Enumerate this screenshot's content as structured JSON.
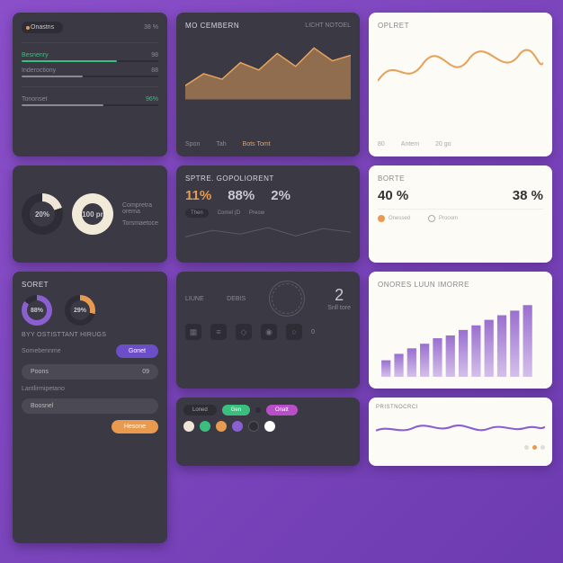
{
  "card1": {
    "tab": "Onastns",
    "pct_right": "38 %",
    "m1_label": "Besnenry",
    "m1_value": "98",
    "m2_label": "Inderoctiony",
    "m2_value": "88",
    "m3_label": "Tononset",
    "m3_value": "96%"
  },
  "card2": {
    "title": "MO CEMBERN",
    "title2": "LICHT NOTOEL",
    "stats": [
      "Spon",
      "Tah",
      "Bots Tomt"
    ]
  },
  "card3": {
    "title": "OPLRET",
    "stats": [
      "80",
      "Antem",
      "20 go"
    ]
  },
  "card4": {
    "d1": "20%",
    "d2": "100 pr",
    "cap1": "Compretra orema",
    "cap2": "Torsmaetoce"
  },
  "card5": {
    "title": "SPTRE. GOPOLIORENT",
    "p1": "11%",
    "p2": "88%",
    "p3": "2%",
    "chip1": "Then",
    "chip2": "Comel (D",
    "chip3": "Preow"
  },
  "card6": {
    "title": "BORTE",
    "p1": "40 %",
    "p2": "38 %",
    "r1": "Onessed",
    "r2": "Prooom"
  },
  "card7": {
    "title": "SORET",
    "d1": "88%",
    "d2": "29%",
    "section": "BYY OSTISTTANT HIRUGS",
    "line1": "Somebennme",
    "btn1": "Gonet",
    "field1": "Poons",
    "field1v": "09",
    "line2": "Lantlirmipetano",
    "field2": "Boosnel",
    "btn2": "Hesone"
  },
  "card8": {
    "h1": "LIUNE",
    "h2": "DEBIS",
    "big": "2",
    "biglabel": "Snll tore"
  },
  "card9": {
    "title": "ONORES LUUN IMORRE"
  },
  "card10": {
    "b1": "Loned",
    "b2": "Gen",
    "b3": "Onatt"
  },
  "card11": {
    "title": "PRISTNOCRCI"
  },
  "chart_data": [
    {
      "type": "area",
      "card": 2,
      "x": [
        0,
        1,
        2,
        3,
        4,
        5,
        6,
        7,
        8
      ],
      "values": [
        20,
        32,
        28,
        45,
        38,
        55,
        42,
        60,
        48
      ],
      "ylim": [
        0,
        70
      ],
      "color": "#e6a25a"
    },
    {
      "type": "line",
      "card": 3,
      "x": [
        0,
        1,
        2,
        3,
        4,
        5,
        6
      ],
      "values": [
        30,
        55,
        25,
        60,
        35,
        58,
        32
      ],
      "ylim": [
        0,
        70
      ],
      "color": "#e6a25a"
    },
    {
      "type": "bar",
      "card": 9,
      "categories": [
        "",
        "",
        "",
        "",
        "",
        "",
        "",
        "",
        "",
        "",
        "",
        ""
      ],
      "values": [
        20,
        28,
        34,
        40,
        46,
        50,
        56,
        62,
        68,
        74,
        80,
        86
      ],
      "ylim": [
        0,
        100
      ],
      "color": "#b89ad8"
    },
    {
      "type": "line",
      "card": 11,
      "x": [
        0,
        1,
        2,
        3,
        4,
        5,
        6,
        7,
        8,
        9
      ],
      "values": [
        40,
        45,
        35,
        50,
        42,
        48,
        38,
        46,
        44,
        47
      ],
      "ylim": [
        0,
        70
      ],
      "color": "#8a5fd0"
    }
  ]
}
